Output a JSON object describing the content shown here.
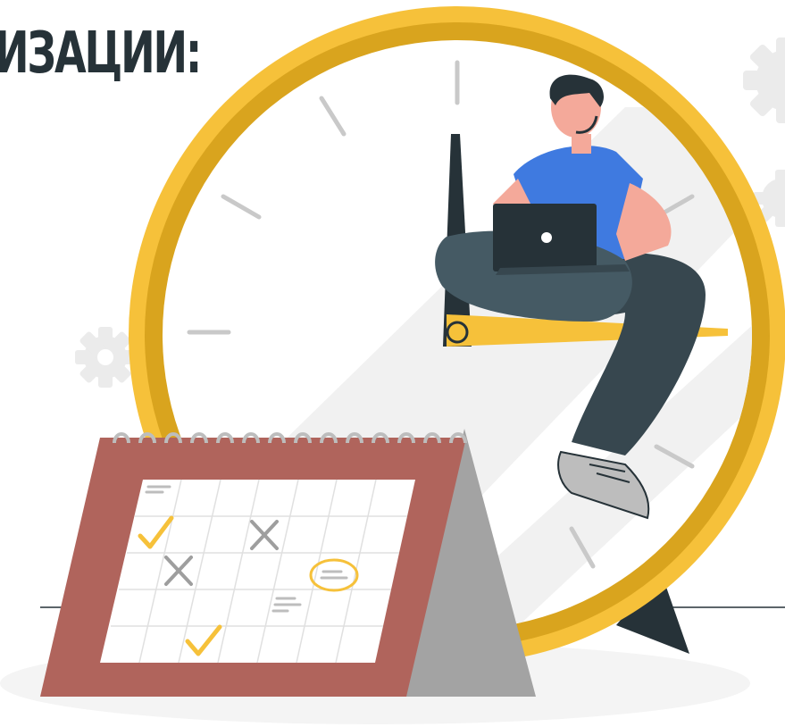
{
  "heading": {
    "text": "ИЗАЦИИ:"
  },
  "colors": {
    "clock_rim": "#F6C13A",
    "clock_rim_shadow": "#D9A41E",
    "clock_hands": "#263238",
    "shirt": "#3F7AE0",
    "pants": "#455A64",
    "skin": "#F4A99A",
    "calendar_cover": "#B0645C",
    "calendar_stand": "#A3A3A3",
    "checkmark": "#F6C13A",
    "cross": "#9E9E9E",
    "shadow": "#F2F2F2",
    "gear": "#EBEBEB"
  },
  "icons": [
    "gear-icon",
    "checkmark-icon",
    "cross-icon",
    "note-icon"
  ]
}
